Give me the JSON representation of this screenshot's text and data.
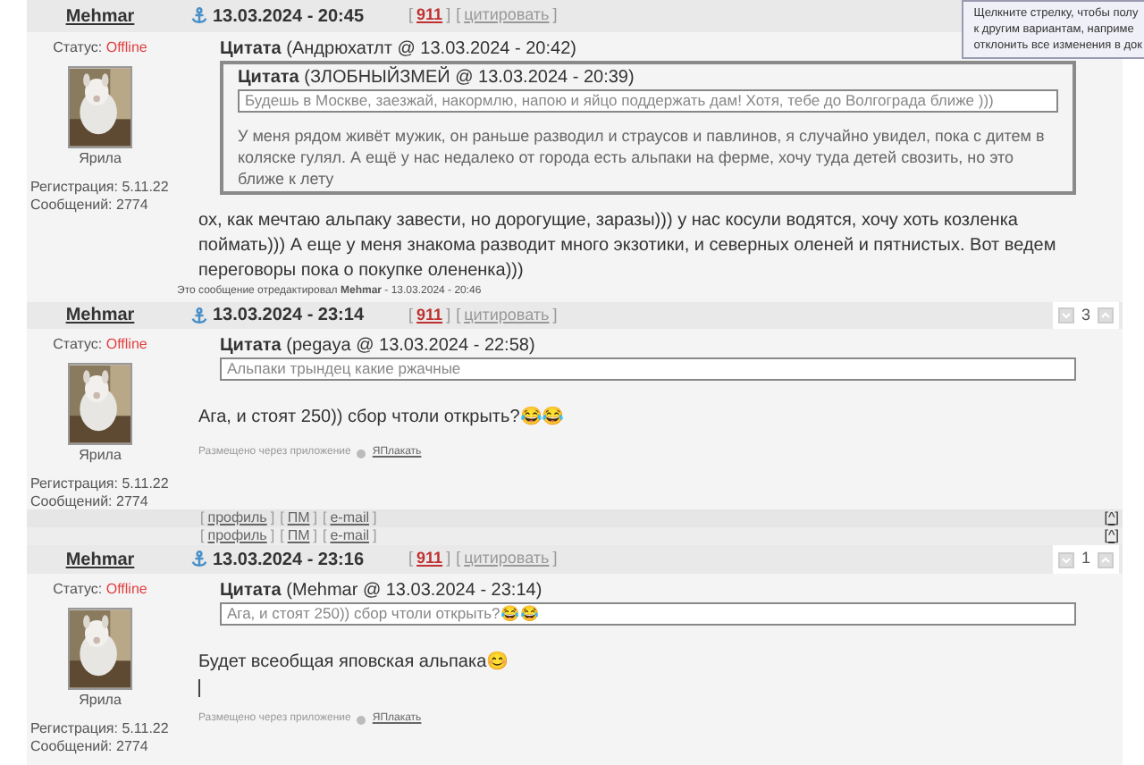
{
  "brackets": [
    "[",
    "]"
  ],
  "tooltip": {
    "lines": [
      "Щелкните стрелку, чтобы полу",
      "к другим вариантам, наприме",
      "отклонить все изменения в док"
    ]
  },
  "posts": [
    {
      "author": "Mehmar",
      "status_label": "Статус:",
      "status": "Offline",
      "avatar": {
        "kind": "picture"
      },
      "avatar_caption": "Ярила",
      "registration": "Регистрация: 5.11.22",
      "messages": "Сообщений: 2774",
      "date": "13.03.2024 - 20:45",
      "number": "911",
      "quote_link": "цитировать",
      "quote": {
        "label": "Цитата",
        "source": "(Андрюхатлт @ 13.03.2024 - 20:42)",
        "text": "У меня рядом живёт мужик, он раньше разводил и страусов и павлинов, я случайно увидел, пока с дитем в коляске гулял. А ещё у нас недалеко от города есть альпаки на ферме, хочу туда детей свозить, но это ближе к лету",
        "nested": {
          "label": "Цитата",
          "source": "(ЗЛОБНЫЙЗМЕЙ @ 13.03.2024 - 20:39)",
          "text": "Будешь в Москве, заезжай, накормлю, напою и яйцо поддержать дам! Хотя, тебе до Волгограда ближе )))"
        }
      },
      "body": "ох, как мечтаю альпаку завести, но дорогущие, заразы))) у нас косули водятся, хочу хоть козленка поймать))) А еще у меня знакома разводит много экзотики, и северных оленей и пятнистых. Вот ведем переговоры пока о покупке олененка)))",
      "edit_note": "Это сообщение отредактировал **Mehmar** - 13.03.2024 - 20:46"
    },
    {
      "author": "Mehmar",
      "status_label": "Статус:",
      "status": "Offline",
      "avatar": {
        "kind": "picture"
      },
      "avatar_caption": "Ярила",
      "registration": "Регистрация: 5.11.22",
      "messages": "Сообщений: 2774",
      "date": "13.03.2024 - 23:14",
      "number": "911",
      "quote_link": "цитировать",
      "rating": "3",
      "quote": {
        "label": "Цитата",
        "source": "(pegaya @ 13.03.2024 - 22:58)",
        "text": "Альпаки трындец какие ржачные"
      },
      "body": "Ага, и стоят 250)) сбор чтоли открыть?😂😂",
      "via": {
        "text": "Размещено через приложение",
        "link": "ЯПлакать"
      },
      "footer_rows": [
        {
          "links": [
            "профиль",
            "ПМ",
            "e-mail"
          ],
          "top": "^"
        },
        {
          "links": [
            "профиль",
            "ПМ",
            "e-mail"
          ],
          "top": "^"
        }
      ]
    },
    {
      "author": "Mehmar",
      "status_label": "Статус:",
      "status": "Offline",
      "avatar": {
        "kind": "picture"
      },
      "avatar_caption": "Ярила",
      "registration": "Регистрация: 5.11.22",
      "messages": "Сообщений: 2774",
      "date": "13.03.2024 - 23:16",
      "number": "911",
      "quote_link": "цитировать",
      "rating": "1",
      "quote": {
        "label": "Цитата",
        "source": "(Mehmar @ 13.03.2024 - 23:14)",
        "text": "Ага, и стоят 250)) сбор чтоли открыть?😂😂"
      },
      "body": "Будет всеобщая яповская альпака😊",
      "cursor": true,
      "via": {
        "text": "Размещено через приложение",
        "link": "ЯПлакать"
      }
    }
  ]
}
